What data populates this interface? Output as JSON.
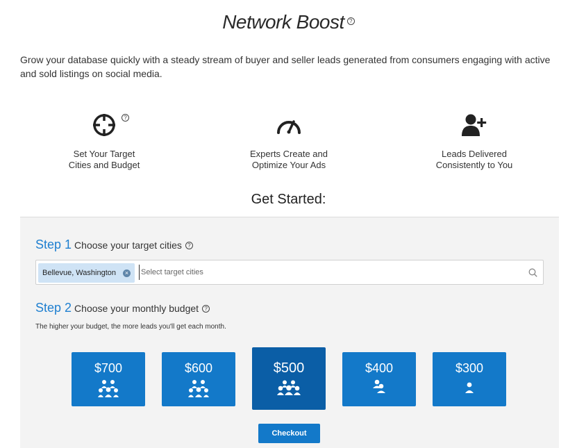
{
  "header": {
    "title": "Network Boost",
    "help_glyph": "?"
  },
  "intro": "Grow your database quickly with a steady stream of buyer and seller leads generated from consumers engaging with active and sold listings on social media.",
  "features": [
    {
      "icon": "crosshair-target-icon",
      "line1": "Set Your Target",
      "line2": "Cities and Budget"
    },
    {
      "icon": "speedometer-icon",
      "line1": "Experts Create and",
      "line2": "Optimize Your Ads"
    },
    {
      "icon": "add-user-icon",
      "line1": "Leads Delivered",
      "line2": "Consistently to You"
    }
  ],
  "get_started": "Get Started:",
  "step1": {
    "num": "Step 1",
    "text": "Choose your target cities",
    "chip": "Bellevue, Washington",
    "chip_remove": "×",
    "placeholder": "Select target cities"
  },
  "step2": {
    "num": "Step 2",
    "text": "Choose your monthly budget",
    "hint": "The higher your budget, the more leads you'll get each month."
  },
  "budgets": [
    {
      "amount": "$700",
      "people": 6,
      "selected": false
    },
    {
      "amount": "$600",
      "people": 6,
      "selected": false
    },
    {
      "amount": "$500",
      "people": 5,
      "selected": true
    },
    {
      "amount": "$400",
      "people": 2,
      "selected": false
    },
    {
      "amount": "$300",
      "people": 1,
      "selected": false
    }
  ],
  "checkout_label": "Checkout",
  "colors": {
    "accent": "#1379c9",
    "accent_selected": "#0b5ea6",
    "step_blue": "#1e7fd0",
    "panel_bg": "#f3f3f3",
    "chip_bg": "#cfe3f5"
  }
}
